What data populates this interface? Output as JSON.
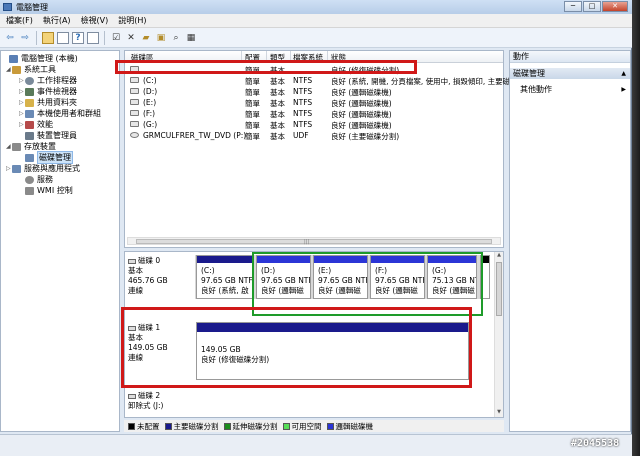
{
  "window": {
    "title": "電腦管理",
    "caption": {
      "minimize": "─",
      "maximize": "□",
      "close": "✕"
    }
  },
  "menu": [
    "檔案(F)",
    "執行(A)",
    "檢視(V)",
    "說明(H)"
  ],
  "tree": [
    {
      "label": "電腦管理 (本機)",
      "icon_color": "#5a7fb5"
    },
    {
      "label": "系統工具",
      "icon_color": "#c99a3a"
    },
    {
      "label": "工作排程器",
      "icon_color": "#7a8a9a"
    },
    {
      "label": "事件檢視器",
      "icon_color": "#5a7a5a"
    },
    {
      "label": "共用資料夾",
      "icon_color": "#d7b24a"
    },
    {
      "label": "本機使用者和群組",
      "icon_color": "#6a8ab5"
    },
    {
      "label": "效能",
      "icon_color": "#b54a4a"
    },
    {
      "label": "裝置管理員",
      "icon_color": "#6a7a8a"
    },
    {
      "label": "存放裝置",
      "icon_color": "#8a8a8a"
    },
    {
      "label": "磁碟管理",
      "icon_color": "#6a8ab5"
    },
    {
      "label": "服務與應用程式",
      "icon_color": "#6a8ab5"
    },
    {
      "label": "服務",
      "icon_color": "#8a8a8a"
    },
    {
      "label": "WMI 控制",
      "icon_color": "#8a8a8a"
    }
  ],
  "columns": [
    "磁碟區",
    "配置",
    "類型",
    "檔案系統",
    "狀態"
  ],
  "volumes": [
    {
      "name": "",
      "layout": "簡單",
      "type": "基本",
      "fs": "",
      "status": "良好 (修復磁碟分割)"
    },
    {
      "name": "(C:)",
      "layout": "簡單",
      "type": "基本",
      "fs": "NTFS",
      "status": "良好 (系統, 開機, 分頁檔案, 使用中, 損毀傾印, 主要磁"
    },
    {
      "name": "(D:)",
      "layout": "簡單",
      "type": "基本",
      "fs": "NTFS",
      "status": "良好 (邏輯磁碟機)"
    },
    {
      "name": "(E:)",
      "layout": "簡單",
      "type": "基本",
      "fs": "NTFS",
      "status": "良好 (邏輯磁碟機)"
    },
    {
      "name": "(F:)",
      "layout": "簡單",
      "type": "基本",
      "fs": "NTFS",
      "status": "良好 (邏輯磁碟機)"
    },
    {
      "name": "(G:)",
      "layout": "簡單",
      "type": "基本",
      "fs": "NTFS",
      "status": "良好 (邏輯磁碟機)"
    },
    {
      "name": "GRMCULFRER_TW_DVD (P:)",
      "layout": "簡單",
      "type": "基本",
      "fs": "UDF",
      "status": "良好 (主要磁碟分割)"
    }
  ],
  "disks": {
    "disk0": {
      "name": "磁碟 0",
      "kind": "基本",
      "size": "465.76 GB",
      "state": "連線",
      "partitions": [
        {
          "label": "(C:)",
          "size": "97.65 GB NTF",
          "status": "良好 (系統, 啟"
        },
        {
          "label": "(D:)",
          "size": "97.65 GB NTF",
          "status": "良好 (邏輯磁"
        },
        {
          "label": "(E:)",
          "size": "97.65 GB NTF",
          "status": "良好 (邏輯磁"
        },
        {
          "label": "(F:)",
          "size": "97.65 GB NTF",
          "status": "良好 (邏輯磁"
        },
        {
          "label": "(G:)",
          "size": "75.13 GB NTF",
          "status": "良好 (邏輯磁"
        }
      ]
    },
    "disk1": {
      "name": "磁碟 1",
      "kind": "基本",
      "size": "149.05 GB",
      "state": "連線",
      "partition": {
        "size": "149.05 GB",
        "status": "良好 (修復磁碟分割)"
      }
    },
    "disk2": {
      "name": "磁碟 2",
      "kind": "卸除式 (J:)"
    }
  },
  "legend": [
    {
      "label": "未配置",
      "color": "#000000"
    },
    {
      "label": "主要磁碟分割",
      "color": "#1a1a8c"
    },
    {
      "label": "延伸磁碟分割",
      "color": "#1c8c1c"
    },
    {
      "label": "可用空間",
      "color": "#55dd55"
    },
    {
      "label": "邏輯磁碟機",
      "color": "#2b35d6"
    }
  ],
  "actions": {
    "header": "動作",
    "section": "磁碟管理",
    "item": "其他動作"
  },
  "watermark": "#2045538",
  "colors": {
    "highlight_red": "#d01818",
    "highlight_green": "#1e9b2a",
    "primary": "#1a1a8c",
    "logical": "#2b35d6"
  }
}
